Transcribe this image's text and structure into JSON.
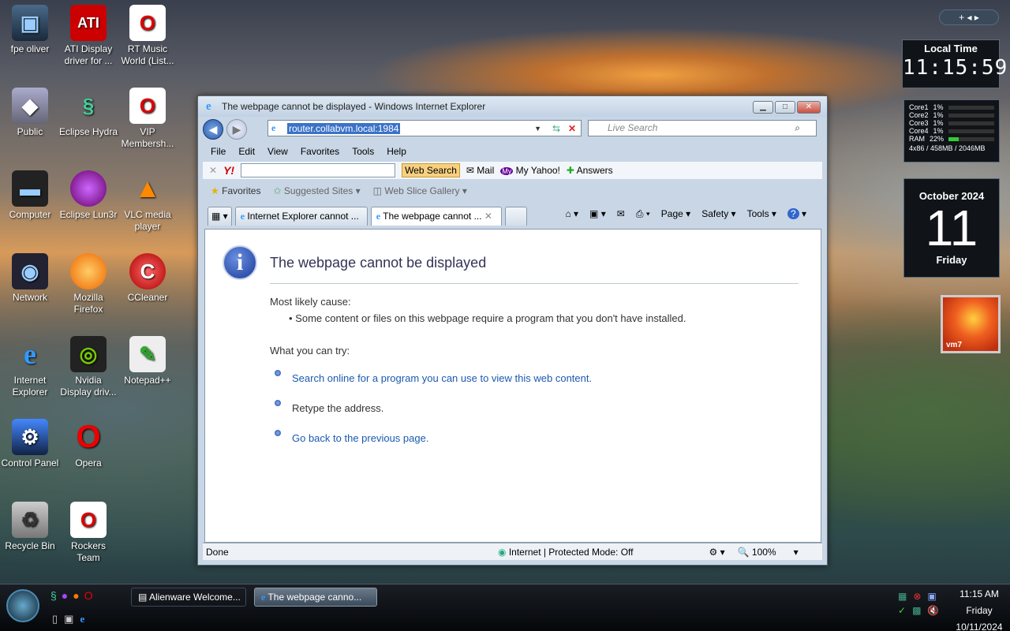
{
  "desktop_icons": [
    {
      "label": "fpe oliver",
      "icon": "user-folder-icon"
    },
    {
      "label": "ATI Display driver for ...",
      "icon": "ati-icon"
    },
    {
      "label": "RT Music World (List...",
      "icon": "opera-shortcut-icon"
    },
    {
      "label": "Public",
      "icon": "folder-icon"
    },
    {
      "label": "Eclipse Hydra",
      "icon": "eclipse-hydra-icon"
    },
    {
      "label": "VIP Membersh...",
      "icon": "opera-shortcut-icon"
    },
    {
      "label": "Computer",
      "icon": "computer-icon"
    },
    {
      "label": "Eclipse Lun3r",
      "icon": "eclipse-lun3r-icon"
    },
    {
      "label": "VLC media player",
      "icon": "vlc-icon"
    },
    {
      "label": "Network",
      "icon": "network-icon"
    },
    {
      "label": "Mozilla Firefox",
      "icon": "firefox-icon"
    },
    {
      "label": "CCleaner",
      "icon": "ccleaner-icon"
    },
    {
      "label": "Internet Explorer",
      "icon": "ie-icon"
    },
    {
      "label": "Nvidia Display driv...",
      "icon": "nvidia-icon"
    },
    {
      "label": "Notepad++",
      "icon": "notepad-icon"
    },
    {
      "label": "Control Panel",
      "icon": "control-panel-icon"
    },
    {
      "label": "Opera",
      "icon": "opera-icon"
    },
    {
      "label": "Recycle Bin",
      "icon": "recycle-bin-icon"
    },
    {
      "label": "Rockers Team",
      "icon": "opera-shortcut-icon"
    }
  ],
  "window": {
    "title": "The webpage cannot be displayed - Windows Internet Explorer"
  },
  "address": {
    "url": "router.collabvm.local:1984",
    "search_placeholder": "Live Search"
  },
  "menu": [
    "File",
    "Edit",
    "View",
    "Favorites",
    "Tools",
    "Help"
  ],
  "yahoo": {
    "search_btn": "Web Search",
    "mail": "Mail",
    "my_yahoo": "My Yahoo!",
    "answers": "Answers"
  },
  "favbar": {
    "favorites": "Favorites",
    "suggested": "Suggested Sites",
    "slice": "Web Slice Gallery"
  },
  "tabs": [
    {
      "label": "Internet Explorer cannot ..."
    },
    {
      "label": "The webpage cannot ..."
    }
  ],
  "cmds": {
    "page": "Page",
    "safety": "Safety",
    "tools": "Tools"
  },
  "page": {
    "heading": "The webpage cannot be displayed",
    "cause_title": "Most likely cause:",
    "cause": "Some content or files on this webpage require a program that you don't have installed.",
    "try_title": "What you can try:",
    "try1": "Search online for a program you can use to view this web content.",
    "try2": "Retype the address.",
    "try3": "Go back to the previous page."
  },
  "status": {
    "text": "Done",
    "zone": "Internet | Protected Mode: Off",
    "zoom": "100%"
  },
  "gadgets": {
    "clock_title": "Local Time",
    "clock_time": "11:15:59",
    "cpu": [
      {
        "name": "Core1",
        "val": "1%"
      },
      {
        "name": "Core2",
        "val": "1%"
      },
      {
        "name": "Core3",
        "val": "1%"
      },
      {
        "name": "Core4",
        "val": "1%"
      },
      {
        "name": "RAM",
        "val": "22%"
      }
    ],
    "cpu_footer": "4x86 / 458MB / 2046MB",
    "cal_month": "October 2024",
    "cal_day": "11",
    "cal_weekday": "Friday",
    "photo_label": "vm7"
  },
  "taskbar": {
    "buttons": [
      {
        "label": "Alienware Welcome..."
      },
      {
        "label": "The webpage canno..."
      }
    ],
    "time": "11:15 AM",
    "day": "Friday",
    "date": "10/11/2024"
  }
}
